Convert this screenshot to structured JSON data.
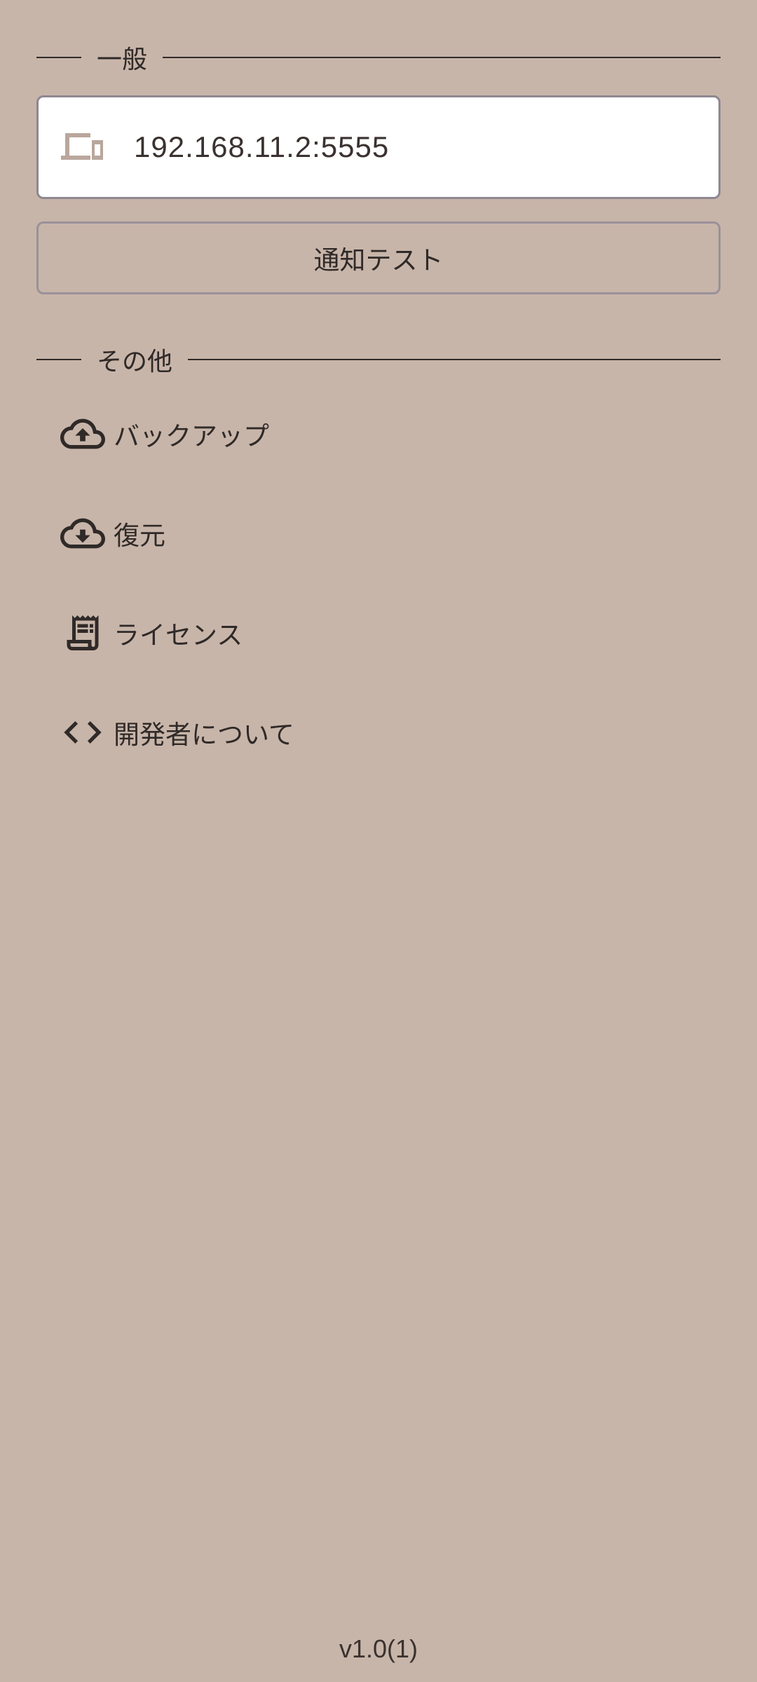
{
  "sections": {
    "general": {
      "title": "一般"
    },
    "other": {
      "title": "その他"
    }
  },
  "ip_field": {
    "value": "192.168.11.2:5555",
    "icon": "devices-icon"
  },
  "notify_test_button": {
    "label": "通知テスト"
  },
  "menu": {
    "items": [
      {
        "label": "バックアップ",
        "icon": "cloud-upload-icon"
      },
      {
        "label": "復元",
        "icon": "cloud-download-icon"
      },
      {
        "label": "ライセンス",
        "icon": "receipt-icon"
      },
      {
        "label": "開発者について",
        "icon": "code-icon"
      }
    ]
  },
  "version": "v1.0(1)",
  "colors": {
    "background": "#c8b5a9",
    "text": "#2f2a28",
    "field_background": "#ffffff",
    "field_border": "#8e8791",
    "device_icon": "#b9a79c"
  }
}
